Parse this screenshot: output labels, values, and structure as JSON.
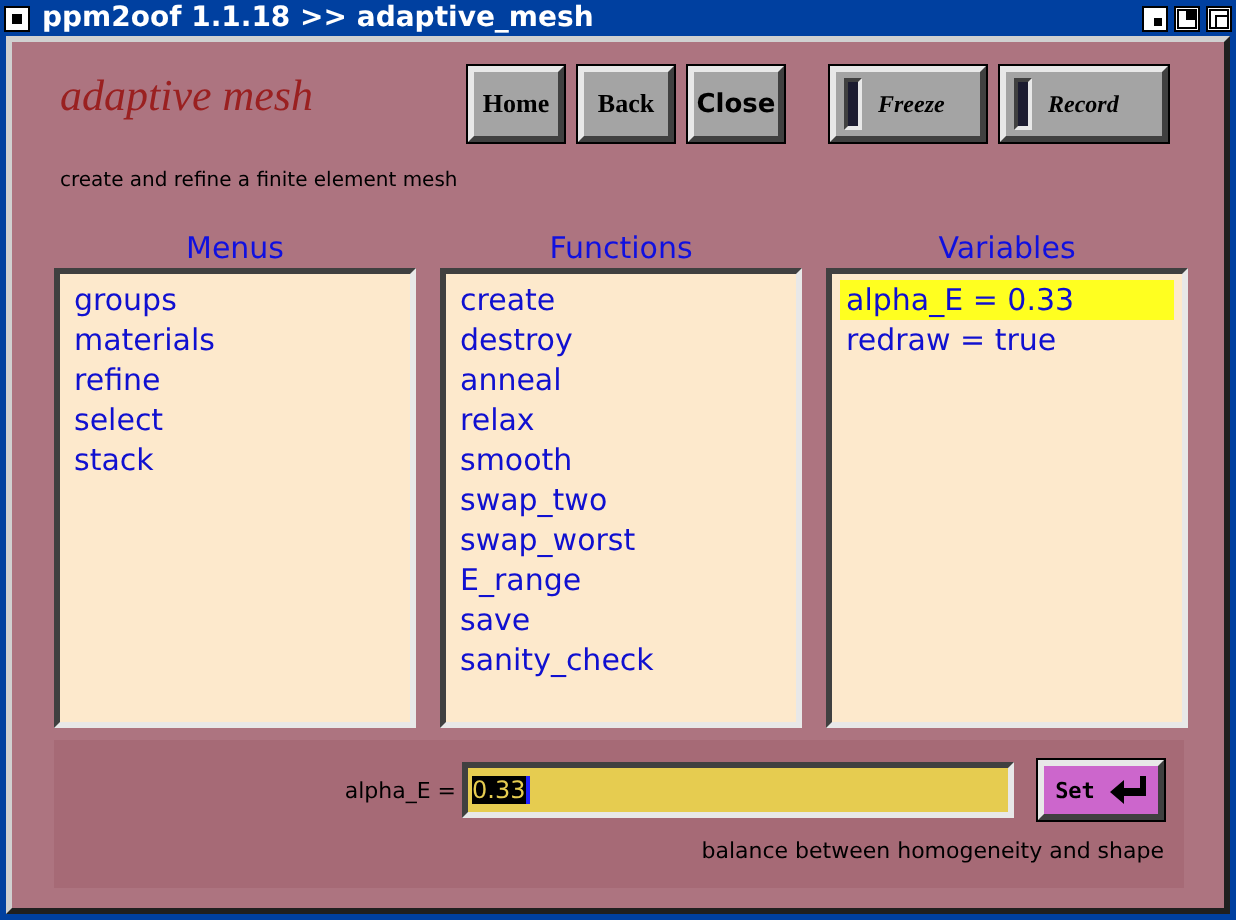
{
  "window": {
    "title": "ppm2oof 1.1.18 >> adaptive_mesh"
  },
  "header": {
    "title": "adaptive mesh",
    "subtitle": "create and refine a finite element mesh"
  },
  "buttons": [
    {
      "label": "Home",
      "kind": "push"
    },
    {
      "label": "Back",
      "kind": "push"
    },
    {
      "label": "Close",
      "kind": "push"
    },
    {
      "label": "Freeze",
      "kind": "toggle",
      "on": false
    },
    {
      "label": "Record",
      "kind": "toggle",
      "on": false
    }
  ],
  "lists": [
    {
      "heading": "Menus",
      "items": [
        {
          "label": "groups",
          "selected": false
        },
        {
          "label": "materials",
          "selected": false
        },
        {
          "label": "refine",
          "selected": false
        },
        {
          "label": "select",
          "selected": false
        },
        {
          "label": "stack",
          "selected": false
        }
      ]
    },
    {
      "heading": "Functions",
      "items": [
        {
          "label": "create",
          "selected": false
        },
        {
          "label": "destroy",
          "selected": false
        },
        {
          "label": "anneal",
          "selected": false
        },
        {
          "label": "relax",
          "selected": false
        },
        {
          "label": "smooth",
          "selected": false
        },
        {
          "label": "swap_two",
          "selected": false
        },
        {
          "label": "swap_worst",
          "selected": false
        },
        {
          "label": "E_range",
          "selected": false
        },
        {
          "label": "save",
          "selected": false
        },
        {
          "label": "sanity_check",
          "selected": false
        }
      ]
    },
    {
      "heading": "Variables",
      "items": [
        {
          "label": "alpha_E = 0.33",
          "selected": true
        },
        {
          "label": "redraw = true",
          "selected": false
        }
      ]
    }
  ],
  "setter": {
    "label": "alpha_E =",
    "value": "0.33",
    "button": "Set",
    "help": "balance between homogeneity and shape"
  }
}
